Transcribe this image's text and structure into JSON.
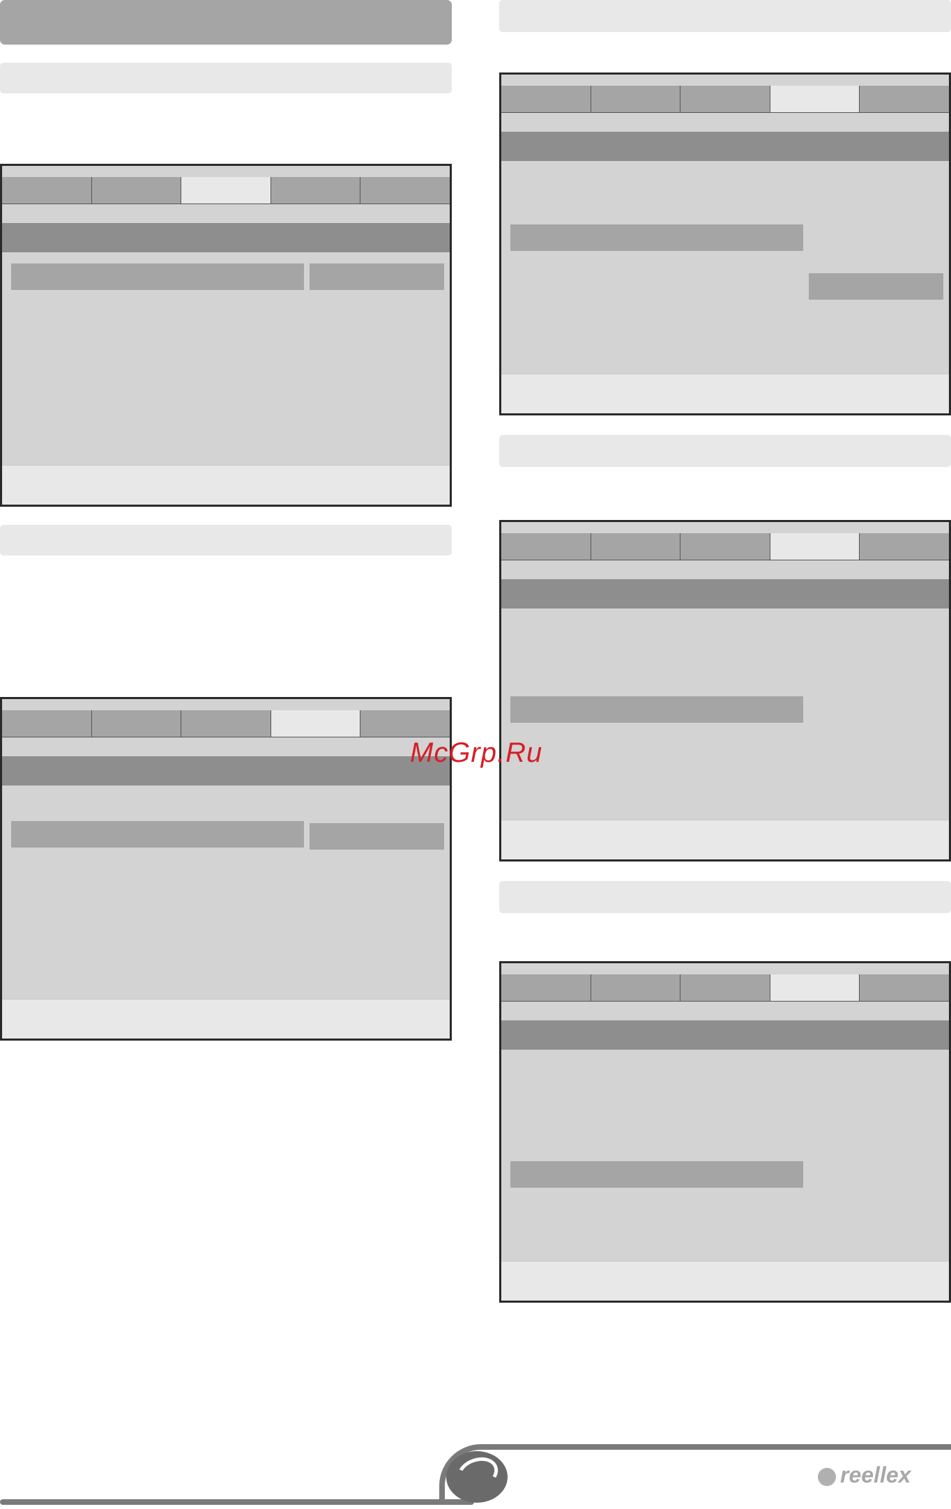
{
  "watermark": "McGrp.Ru",
  "brand": {
    "name": "reellex",
    "logo_icon": "reellex-swirl-icon"
  },
  "colors": {
    "title_bar": "#a6a5a6",
    "section_bar": "#e8e8e8",
    "screen_body": "#d3d3d3",
    "header_strip": "#8f8e8f",
    "active_tab": "#e8e8e8",
    "watermark": "#d41f27"
  },
  "screens": [
    {
      "id": "screen-1",
      "active_tab_index": 2
    },
    {
      "id": "screen-2",
      "active_tab_index": 3
    },
    {
      "id": "screen-3",
      "active_tab_index": 3
    },
    {
      "id": "screen-4",
      "active_tab_index": 3
    },
    {
      "id": "screen-5",
      "active_tab_index": 3
    }
  ]
}
